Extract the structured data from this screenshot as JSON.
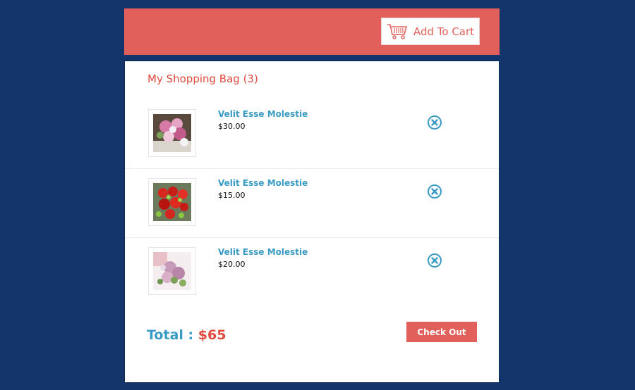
{
  "header": {
    "cart_button_label": "Add To Cart",
    "accent_color": "#e2605b",
    "cart_icon": "shopping-cart-icon"
  },
  "bag": {
    "title": "My Shopping Bag (3)",
    "items": [
      {
        "name": "Velit Esse Molestie",
        "price": "$30.00",
        "image": "pink-bouquet"
      },
      {
        "name": "Velit Esse Molestie",
        "price": "$15.00",
        "image": "red-roses-bouquet"
      },
      {
        "name": "Velit Esse Molestie",
        "price": "$20.00",
        "image": "lilac-bouquet"
      }
    ],
    "remove_icon": "remove-circle-icon"
  },
  "summary": {
    "total_label": "Total :",
    "total_amount": "$65",
    "checkout_label": "Check Out"
  },
  "colors": {
    "background": "#14356b",
    "link_blue": "#3a9bc4",
    "title_red": "#e24a3f"
  }
}
